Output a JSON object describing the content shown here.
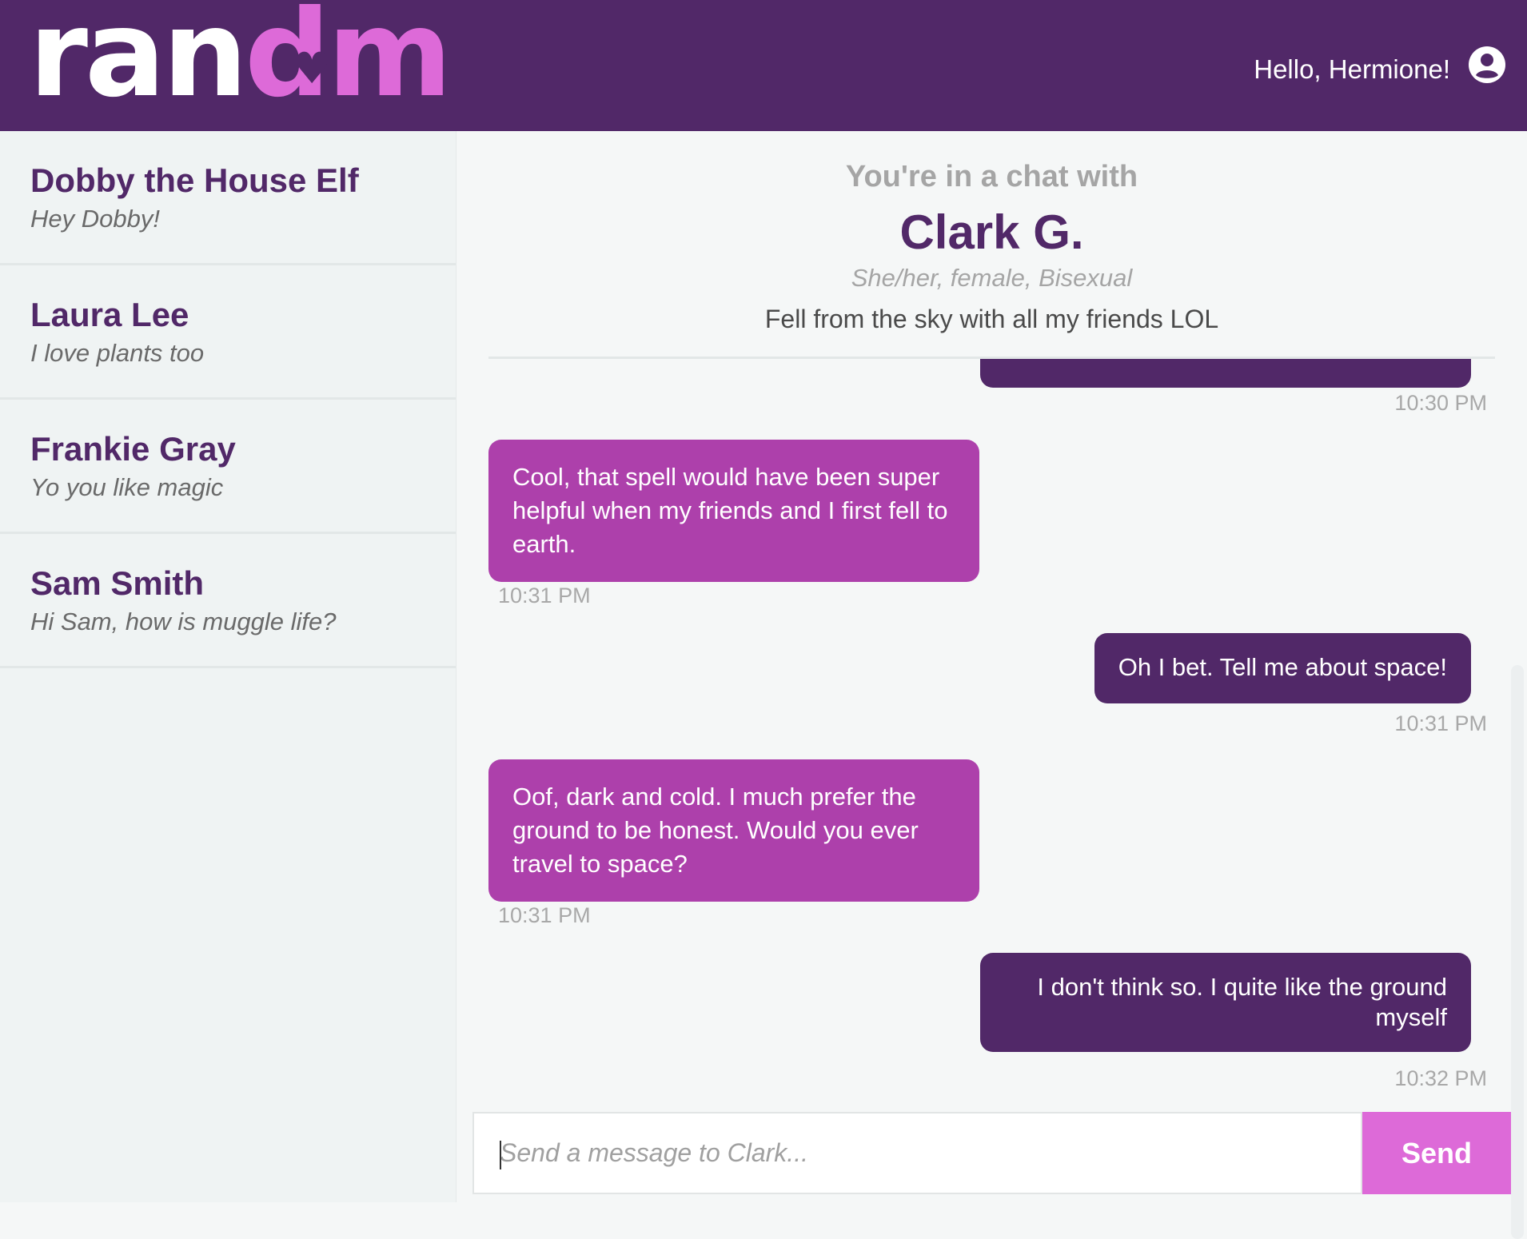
{
  "header": {
    "logo_part_a": "ran",
    "logo_part_b": "dm",
    "greeting": "Hello, Hermione!"
  },
  "sidebar": {
    "conversations": [
      {
        "name": "Dobby the House Elf",
        "preview": "Hey Dobby!"
      },
      {
        "name": "Laura Lee",
        "preview": "I love plants too"
      },
      {
        "name": "Frankie Gray",
        "preview": "Yo you like magic"
      },
      {
        "name": "Sam Smith",
        "preview": "Hi Sam, how is muggle life?"
      }
    ]
  },
  "chat": {
    "intro": "You're in a chat with",
    "partner_name": "Clark G.",
    "partner_details": "She/her, female, Bisexual",
    "partner_bio": "Fell from the sky with all my friends LOL",
    "messages": [
      {
        "from": "me",
        "text": "",
        "time": "10:30 PM"
      },
      {
        "from": "them",
        "text": "Cool, that spell would have been super helpful when my friends and I first fell to earth.",
        "time": "10:31 PM"
      },
      {
        "from": "me",
        "text": "Oh I bet. Tell me about space!",
        "time": "10:31 PM"
      },
      {
        "from": "them",
        "text": "Oof, dark and cold. I much prefer the ground to be honest. Would you ever travel to space?",
        "time": "10:31 PM"
      },
      {
        "from": "me",
        "text": "I don't think so. I quite like the ground myself",
        "time": "10:32 PM"
      }
    ]
  },
  "composer": {
    "placeholder": "Send a message to Clark...",
    "send_label": "Send"
  },
  "colors": {
    "brand_purple": "#512868",
    "brand_pink": "#dd6ad8",
    "them_bubble": "#ad40ab"
  },
  "icons": {
    "user": "user-circle-icon",
    "logo_heart": "heart-icon"
  }
}
